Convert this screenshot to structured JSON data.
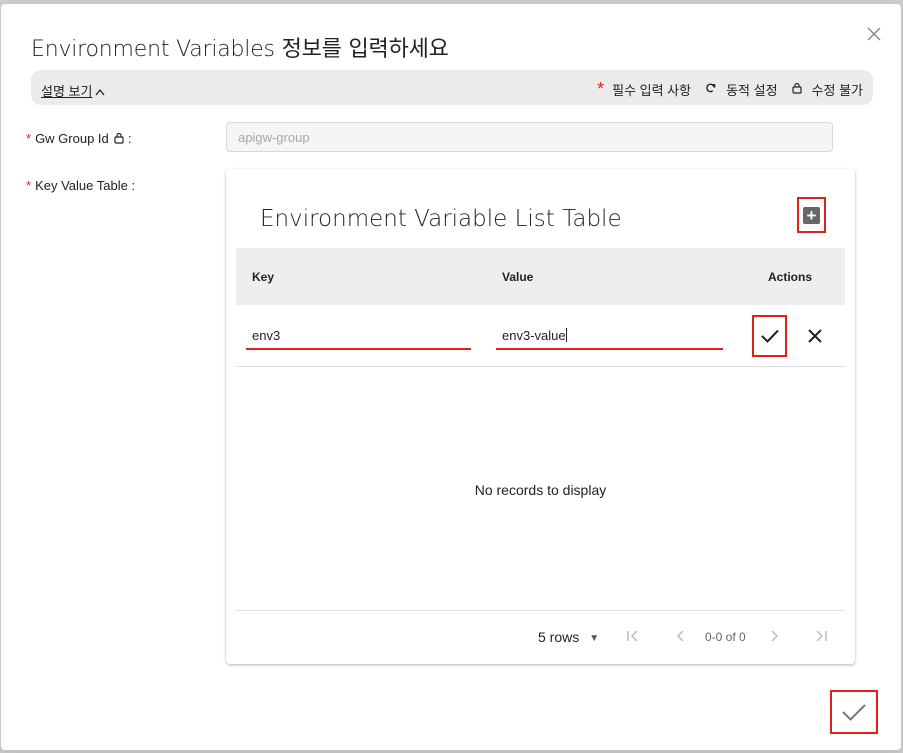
{
  "dialog": {
    "title": "Environment Variables 정보를 입력하세요",
    "close_icon": "close-icon"
  },
  "info_bar": {
    "description_toggle": "설명 보기",
    "legend": {
      "required": "필수 입력 사항",
      "dynamic": "동적 설정",
      "readonly": "수정 불가"
    }
  },
  "form": {
    "gw_group_label": "Gw Group Id",
    "gw_group_value": "apigw-group",
    "key_value_label": "Key Value Table"
  },
  "table": {
    "title": "Environment Variable List Table",
    "columns": [
      "Key",
      "Value",
      "Actions"
    ],
    "editing_row": {
      "key": "env3",
      "value": "env3-value"
    },
    "empty_message": "No records to display",
    "pagination": {
      "rows_per_page": "5 rows",
      "count_text": "0-0 of 0"
    }
  },
  "colors": {
    "accent_red": "#e0201a",
    "header_bg": "#eeeeee",
    "info_bar_bg": "#ebebeb"
  }
}
